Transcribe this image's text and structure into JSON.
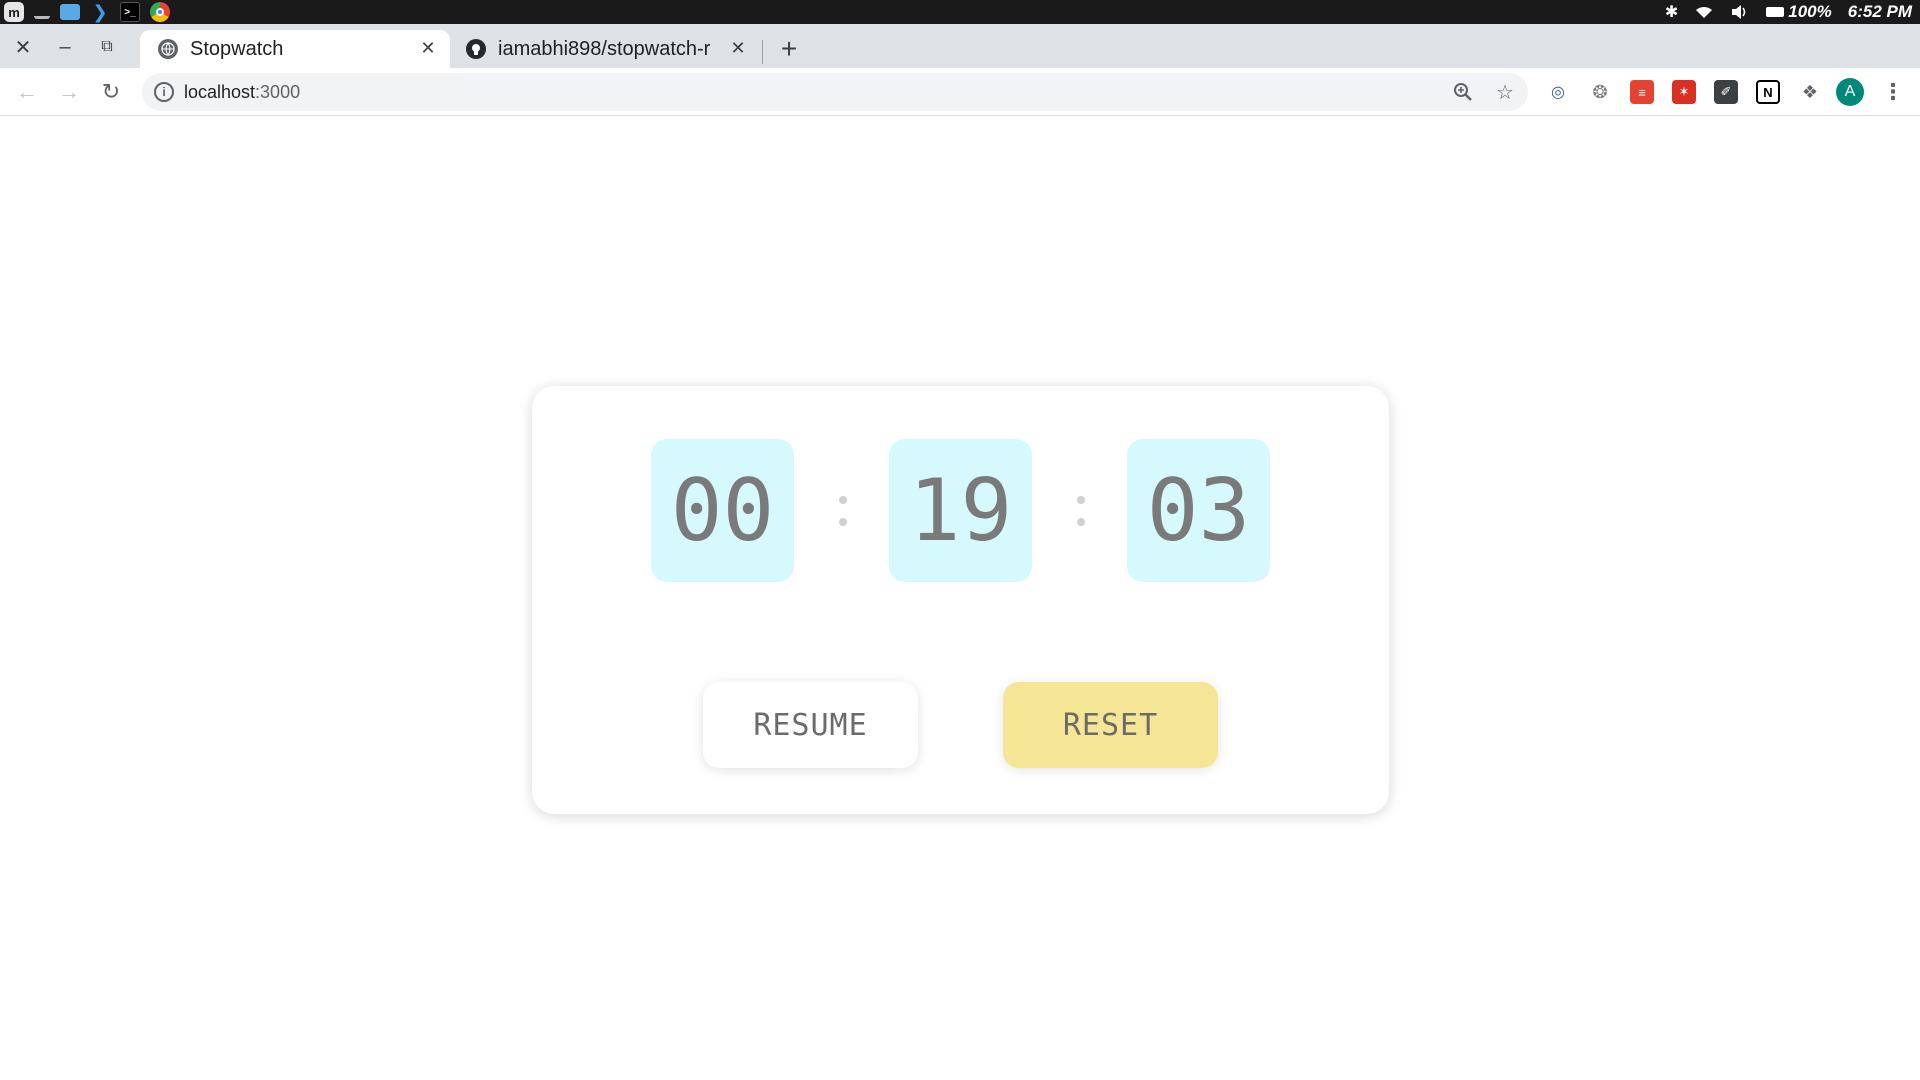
{
  "os": {
    "battery": "100%",
    "clock": "6:52 PM"
  },
  "browser": {
    "tabs": [
      {
        "title": "Stopwatch",
        "active": true
      },
      {
        "title": "iamabhi898/stopwatch-r",
        "active": false
      }
    ],
    "url": {
      "host": "localhost",
      "port": ":3000"
    },
    "avatar_letter": "A"
  },
  "stopwatch": {
    "hours": "00",
    "minutes": "19",
    "seconds": "03",
    "resume_label": "RESUME",
    "reset_label": "RESET"
  },
  "colors": {
    "digit_bg": "#d6f9fd",
    "reset_bg": "#f5e696",
    "avatar": "#00897b"
  }
}
